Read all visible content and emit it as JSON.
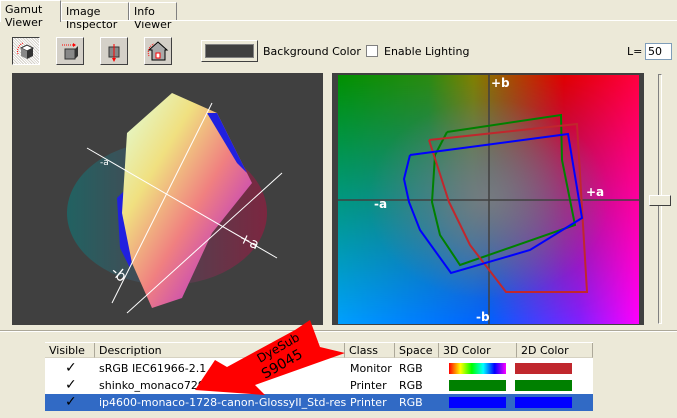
{
  "tabs": [
    {
      "label": "Gamut Viewer",
      "active": true
    },
    {
      "label": "Image Inspector"
    },
    {
      "label": "Info Viewer"
    }
  ],
  "toolbar": {
    "buttons": [
      "rotate-cube-icon",
      "move-cube-icon",
      "scale-cube-icon",
      "home-view-icon"
    ],
    "background_color_label": "Background Color",
    "background_color": "#404040",
    "enable_lighting_label": "Enable Lighting",
    "enable_lighting": false,
    "l_label": "L=",
    "l_value": "50"
  },
  "view2d": {
    "axis_labels": {
      "pos_b": "+b",
      "neg_b": "-b",
      "neg_a": "-a",
      "pos_a": "+a"
    }
  },
  "view3d": {
    "axis_labels": {
      "pos_a": "+a",
      "neg_b": "-b",
      "neg_a": "-a"
    }
  },
  "annotation": {
    "line1": "DyeSub",
    "line2": "S9045",
    "color": "#ff0000"
  },
  "table": {
    "columns": [
      "Visible",
      "Description",
      "Class",
      "Space",
      "3D Color",
      "2D Color"
    ],
    "rows": [
      {
        "visible": "✓",
        "description": "sRGB IEC61966-2.1",
        "class": "Monitor",
        "space": "RGB",
        "color3d": "rainbow",
        "color2d": "#c0272d"
      },
      {
        "visible": "✓",
        "description": "shinko_monaco729",
        "class": "Printer",
        "space": "RGB",
        "color3d": "#008000",
        "color2d": "#008000"
      },
      {
        "visible": "✓",
        "description": "ip4600-monaco-1728-canon-GlossyII_Std-res",
        "class": "Printer",
        "space": "RGB",
        "color3d": "#0000ff",
        "color2d": "#0000ff",
        "selected": true
      }
    ]
  }
}
